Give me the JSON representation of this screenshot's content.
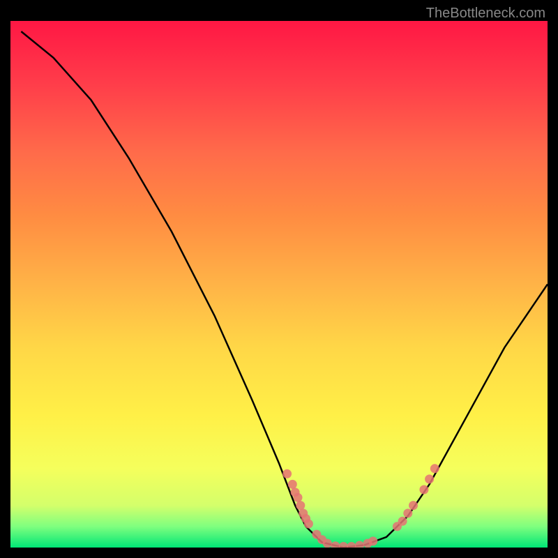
{
  "watermark": "TheBottleneck.com",
  "chart_data": {
    "type": "line",
    "title": "",
    "xlabel": "",
    "ylabel": "",
    "xlim": [
      0,
      100
    ],
    "ylim": [
      0,
      100
    ],
    "grid": false,
    "curve_points": [
      {
        "x": 2,
        "y": 98
      },
      {
        "x": 8,
        "y": 93
      },
      {
        "x": 15,
        "y": 85
      },
      {
        "x": 22,
        "y": 74
      },
      {
        "x": 30,
        "y": 60
      },
      {
        "x": 38,
        "y": 44
      },
      {
        "x": 45,
        "y": 28
      },
      {
        "x": 50,
        "y": 16
      },
      {
        "x": 53,
        "y": 8
      },
      {
        "x": 55,
        "y": 4
      },
      {
        "x": 58,
        "y": 1
      },
      {
        "x": 62,
        "y": 0
      },
      {
        "x": 66,
        "y": 0.5
      },
      {
        "x": 70,
        "y": 2
      },
      {
        "x": 74,
        "y": 6
      },
      {
        "x": 78,
        "y": 12
      },
      {
        "x": 85,
        "y": 25
      },
      {
        "x": 92,
        "y": 38
      },
      {
        "x": 100,
        "y": 50
      }
    ],
    "scatter_points": [
      {
        "x": 51.5,
        "y": 14
      },
      {
        "x": 52.5,
        "y": 12
      },
      {
        "x": 53,
        "y": 10.5
      },
      {
        "x": 53.5,
        "y": 9.5
      },
      {
        "x": 54,
        "y": 8
      },
      {
        "x": 54.5,
        "y": 6.5
      },
      {
        "x": 55,
        "y": 5.5
      },
      {
        "x": 55.5,
        "y": 4.5
      },
      {
        "x": 57,
        "y": 2.5
      },
      {
        "x": 58,
        "y": 1.5
      },
      {
        "x": 59,
        "y": 0.8
      },
      {
        "x": 60.5,
        "y": 0.3
      },
      {
        "x": 62,
        "y": 0.2
      },
      {
        "x": 63.5,
        "y": 0.2
      },
      {
        "x": 65,
        "y": 0.4
      },
      {
        "x": 66.5,
        "y": 0.8
      },
      {
        "x": 67.5,
        "y": 1.2
      },
      {
        "x": 72,
        "y": 4
      },
      {
        "x": 73,
        "y": 5
      },
      {
        "x": 74,
        "y": 6.5
      },
      {
        "x": 75,
        "y": 8
      },
      {
        "x": 77,
        "y": 11
      },
      {
        "x": 78,
        "y": 13
      },
      {
        "x": 79,
        "y": 15
      }
    ],
    "colors": {
      "curve": "#000000",
      "scatter": "#e57373",
      "gradient_top": "#ff1744",
      "gradient_bottom": "#00e676"
    }
  }
}
